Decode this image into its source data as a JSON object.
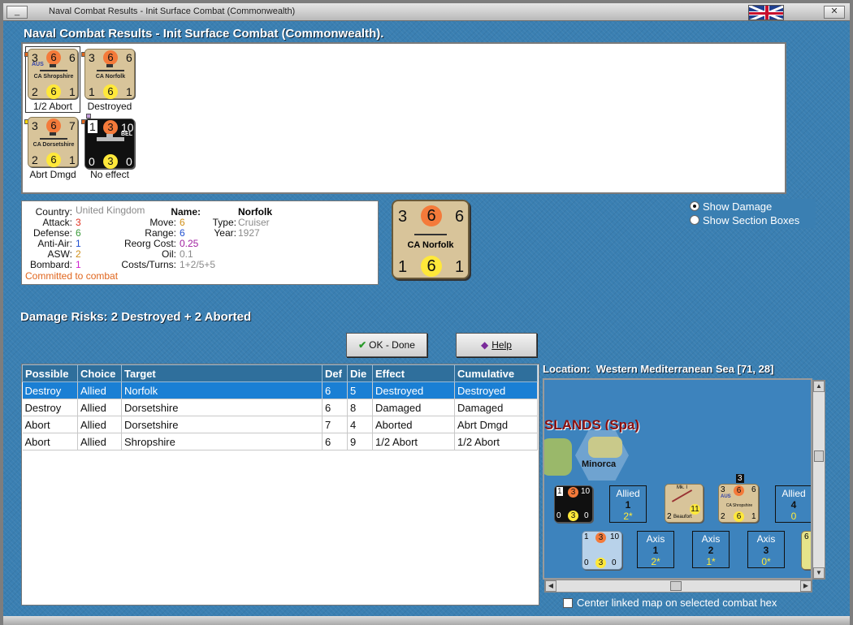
{
  "window": {
    "title": "Naval Combat Results - Init Surface Combat (Commonwealth)",
    "min_label": "_",
    "close_label": "✕"
  },
  "header": {
    "title": "Naval Combat Results - Init Surface Combat (Commonwealth)."
  },
  "units": [
    {
      "top_left": "3",
      "top_mid": "6",
      "top_right": "6",
      "name": "CA Shropshire",
      "nat": "AUS",
      "bot_left": "2",
      "bot_mid": "6",
      "bot_right": "1",
      "result": "1/2 Abort"
    },
    {
      "top_left": "3",
      "top_mid": "6",
      "top_right": "6",
      "name": "CA Norfolk",
      "bot_left": "1",
      "bot_mid": "6",
      "bot_right": "1",
      "result": "Destroyed"
    },
    {
      "top_left": "3",
      "top_mid": "6",
      "top_right": "7",
      "name": "CA Dorsetshire",
      "bot_left": "2",
      "bot_mid": "6",
      "bot_right": "1",
      "result": "Abrt Dmgd"
    },
    {
      "top_left": "1",
      "top_mid": "3",
      "top_right": "10",
      "name": "",
      "nat": "BEL",
      "bot_left": "0",
      "bot_mid": "3",
      "bot_right": "0",
      "result": "No effect"
    }
  ],
  "info": {
    "country_label": "Country:",
    "country": "United Kingdom",
    "attack_label": "Attack:",
    "attack": "3",
    "defense_label": "Defense:",
    "defense": "6",
    "antiair_label": "Anti-Air:",
    "antiair": "1",
    "asw_label": "ASW:",
    "asw": "2",
    "bombard_label": "Bombard:",
    "bombard": "1",
    "committed": "Committed to combat",
    "name_label": "Name:",
    "name": "Norfolk",
    "type_label": "Type:",
    "type": "Cruiser",
    "year_label": "Year:",
    "year": "1927",
    "move_label": "Move:",
    "move": "6",
    "range_label": "Range:",
    "range": "6",
    "reorg_label": "Reorg Cost:",
    "reorg": "0.25",
    "oil_label": "Oil:",
    "oil": "0.1",
    "costs_label": "Costs/Turns:",
    "costs": "1+2/5+5"
  },
  "big_unit": {
    "top_left": "3",
    "top_mid": "6",
    "top_right": "6",
    "name": "CA Norfolk",
    "bot_left": "1",
    "bot_mid": "6",
    "bot_right": "1"
  },
  "options": {
    "show_damage": "Show Damage",
    "show_sections": "Show Section Boxes"
  },
  "damage_risks": "Damage Risks: 2 Destroyed + 2 Aborted",
  "buttons": {
    "ok": "OK - Done",
    "help": "Help"
  },
  "table": {
    "headers": [
      "Possible",
      "Choice",
      "Target",
      "Def",
      "Die",
      "Effect",
      "Cumulative"
    ],
    "rows": [
      [
        "Destroy",
        "Allied",
        "Norfolk",
        "6",
        "5",
        "Destroyed",
        "Destroyed"
      ],
      [
        "Destroy",
        "Allied",
        "Dorsetshire",
        "6",
        "8",
        "Damaged",
        "Damaged"
      ],
      [
        "Abort",
        "Allied",
        "Dorsetshire",
        "7",
        "4",
        "Aborted",
        "Abrt Dmgd"
      ],
      [
        "Abort",
        "Allied",
        "Shropshire",
        "6",
        "9",
        "1/2 Abort",
        "1/2 Abort"
      ]
    ]
  },
  "location": {
    "label": "Location:",
    "value": "Western Mediterranean Sea [71, 28]"
  },
  "map": {
    "region": "SLANDS (Spa)",
    "island": "Minorca",
    "allied_boxes": [
      {
        "label": "Allied",
        "num": "1",
        "sub": "2*"
      },
      {
        "label": "Allied",
        "num": "4",
        "sub": "0"
      }
    ],
    "axis_boxes": [
      {
        "label": "Axis",
        "num": "1",
        "sub": "2*"
      },
      {
        "label": "Axis",
        "num": "2",
        "sub": "1*"
      },
      {
        "label": "Axis",
        "num": "3",
        "sub": "0*"
      }
    ],
    "units": [
      {
        "a": "1",
        "b": "3",
        "c": "10",
        "d": "0",
        "e": "3",
        "f": "0",
        "nat": "BEL"
      },
      {
        "a": "Mk. I",
        "b": "",
        "c": "",
        "d": "2",
        "e": "11",
        "f": "",
        "name": "Beaufort"
      },
      {
        "a": "3",
        "b": "6",
        "c": "6",
        "d": "2",
        "e": "6",
        "f": "1",
        "name": "CA Shropshire",
        "stack": "3",
        "nat": "AUS"
      },
      {
        "a": "1",
        "b": "3",
        "c": "10",
        "d": "0",
        "e": "3",
        "f": "0"
      },
      {
        "a": "6",
        "b": "",
        "c": "",
        "d": "",
        "e": "",
        "f": ""
      }
    ]
  },
  "center_link": "Center linked map on selected combat hex",
  "colors": {
    "accent": "#2f6f9c",
    "selected": "#1a7fd4",
    "attack": "#e0301e",
    "defense": "#3a9a3a",
    "antiair": "#1f4fd0",
    "asw": "#d0901a",
    "bombard": "#d020d0",
    "committed": "#e0661e"
  }
}
